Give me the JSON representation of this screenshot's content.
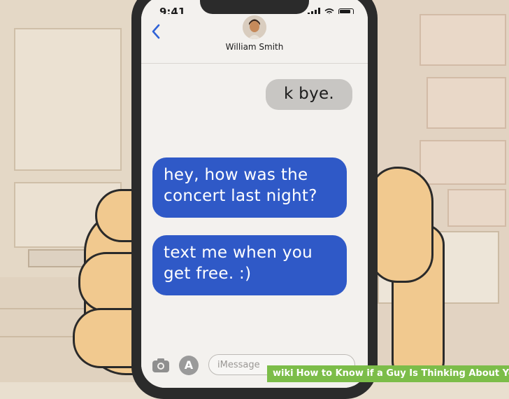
{
  "status_bar": {
    "time": "9:41"
  },
  "header": {
    "contact_name": "William Smith",
    "back_icon": "chevron-left-icon",
    "avatar": "avatar"
  },
  "messages": [
    {
      "direction": "outgoing",
      "text": "k bye."
    },
    {
      "direction": "incoming",
      "text": "hey, how was the concert last night?"
    },
    {
      "direction": "incoming",
      "text": "text me when you get free. :)"
    }
  ],
  "compose": {
    "placeholder": "iMessage",
    "camera_icon": "camera-icon",
    "apps_icon": "app-store-icon"
  },
  "watermark": {
    "brand": "wiki",
    "title": "How to Know if a Guy Is Thinking About You"
  },
  "colors": {
    "incoming_bubble": "#2f59c7",
    "outgoing_bubble": "#c8c6c3",
    "accent": "#2f62d6",
    "watermark_bg": "#7cbd49"
  }
}
